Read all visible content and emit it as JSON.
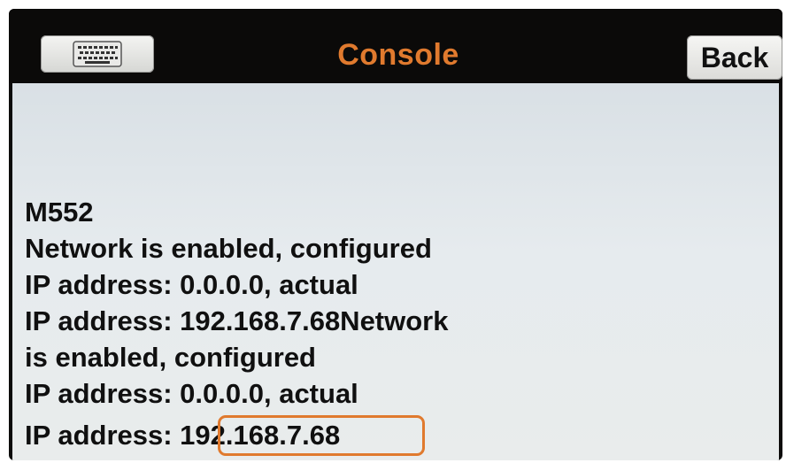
{
  "header": {
    "title": "Console",
    "back_label": "Back",
    "keyboard_icon": "keyboard-icon"
  },
  "console": {
    "lines": [
      "M552",
      "Network is enabled, configured",
      "IP address: 0.0.0.0, actual",
      "IP address: 192.168.7.68Network",
      "is enabled, configured",
      "IP address: 0.0.0.0, actual",
      "IP address: 192.168.7.68"
    ]
  },
  "colors": {
    "title": "#e07a2e",
    "highlight": "#e07a2e",
    "frame": "#0d0c0b",
    "console_bg": "#e6ebee"
  }
}
